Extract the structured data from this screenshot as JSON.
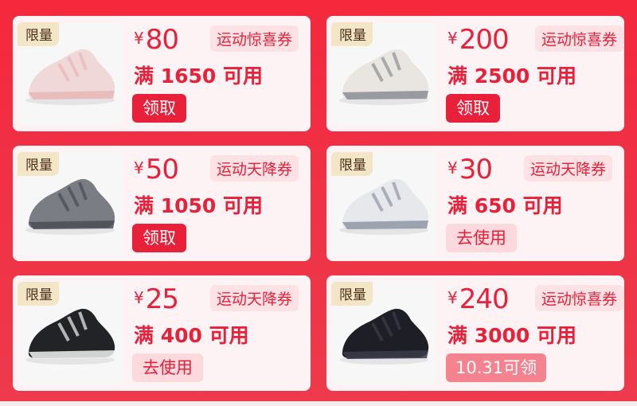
{
  "coupons": [
    {
      "limited": "限量",
      "currency": "¥",
      "amount": "80",
      "type": "运动惊喜券",
      "condition": "满 1650 可用",
      "button": "领取",
      "button_style": "claim",
      "shoe_color": "#f0d8d8",
      "shoe_accent": "#e7b7b7"
    },
    {
      "limited": "限量",
      "currency": "¥",
      "amount": "200",
      "type": "运动惊喜券",
      "condition": "满 2500 可用",
      "button": "领取",
      "button_style": "claim",
      "shoe_color": "#e9e6e2",
      "shoe_accent": "#8b8d92"
    },
    {
      "limited": "限量",
      "currency": "¥",
      "amount": "50",
      "type": "运动天降券",
      "condition": "满 1050 可用",
      "button": "领取",
      "button_style": "claim",
      "shoe_color": "#7b7d84",
      "shoe_accent": "#4a4c52"
    },
    {
      "limited": "限量",
      "currency": "¥",
      "amount": "30",
      "type": "运动天降券",
      "condition": "满 650 可用",
      "button": "去使用",
      "button_style": "use",
      "shoe_color": "#e6e8ec",
      "shoe_accent": "#8e96a3"
    },
    {
      "limited": "限量",
      "currency": "¥",
      "amount": "25",
      "type": "运动天降券",
      "condition": "满 400 可用",
      "button": "去使用",
      "button_style": "use",
      "shoe_color": "#222327",
      "shoe_accent": "#f2f2f2"
    },
    {
      "limited": "限量",
      "currency": "¥",
      "amount": "240",
      "type": "运动惊喜券",
      "condition": "满 3000 可用",
      "button": "10.31可领",
      "button_style": "date",
      "shoe_color": "#1d1e26",
      "shoe_accent": "#3a3c4a"
    }
  ]
}
